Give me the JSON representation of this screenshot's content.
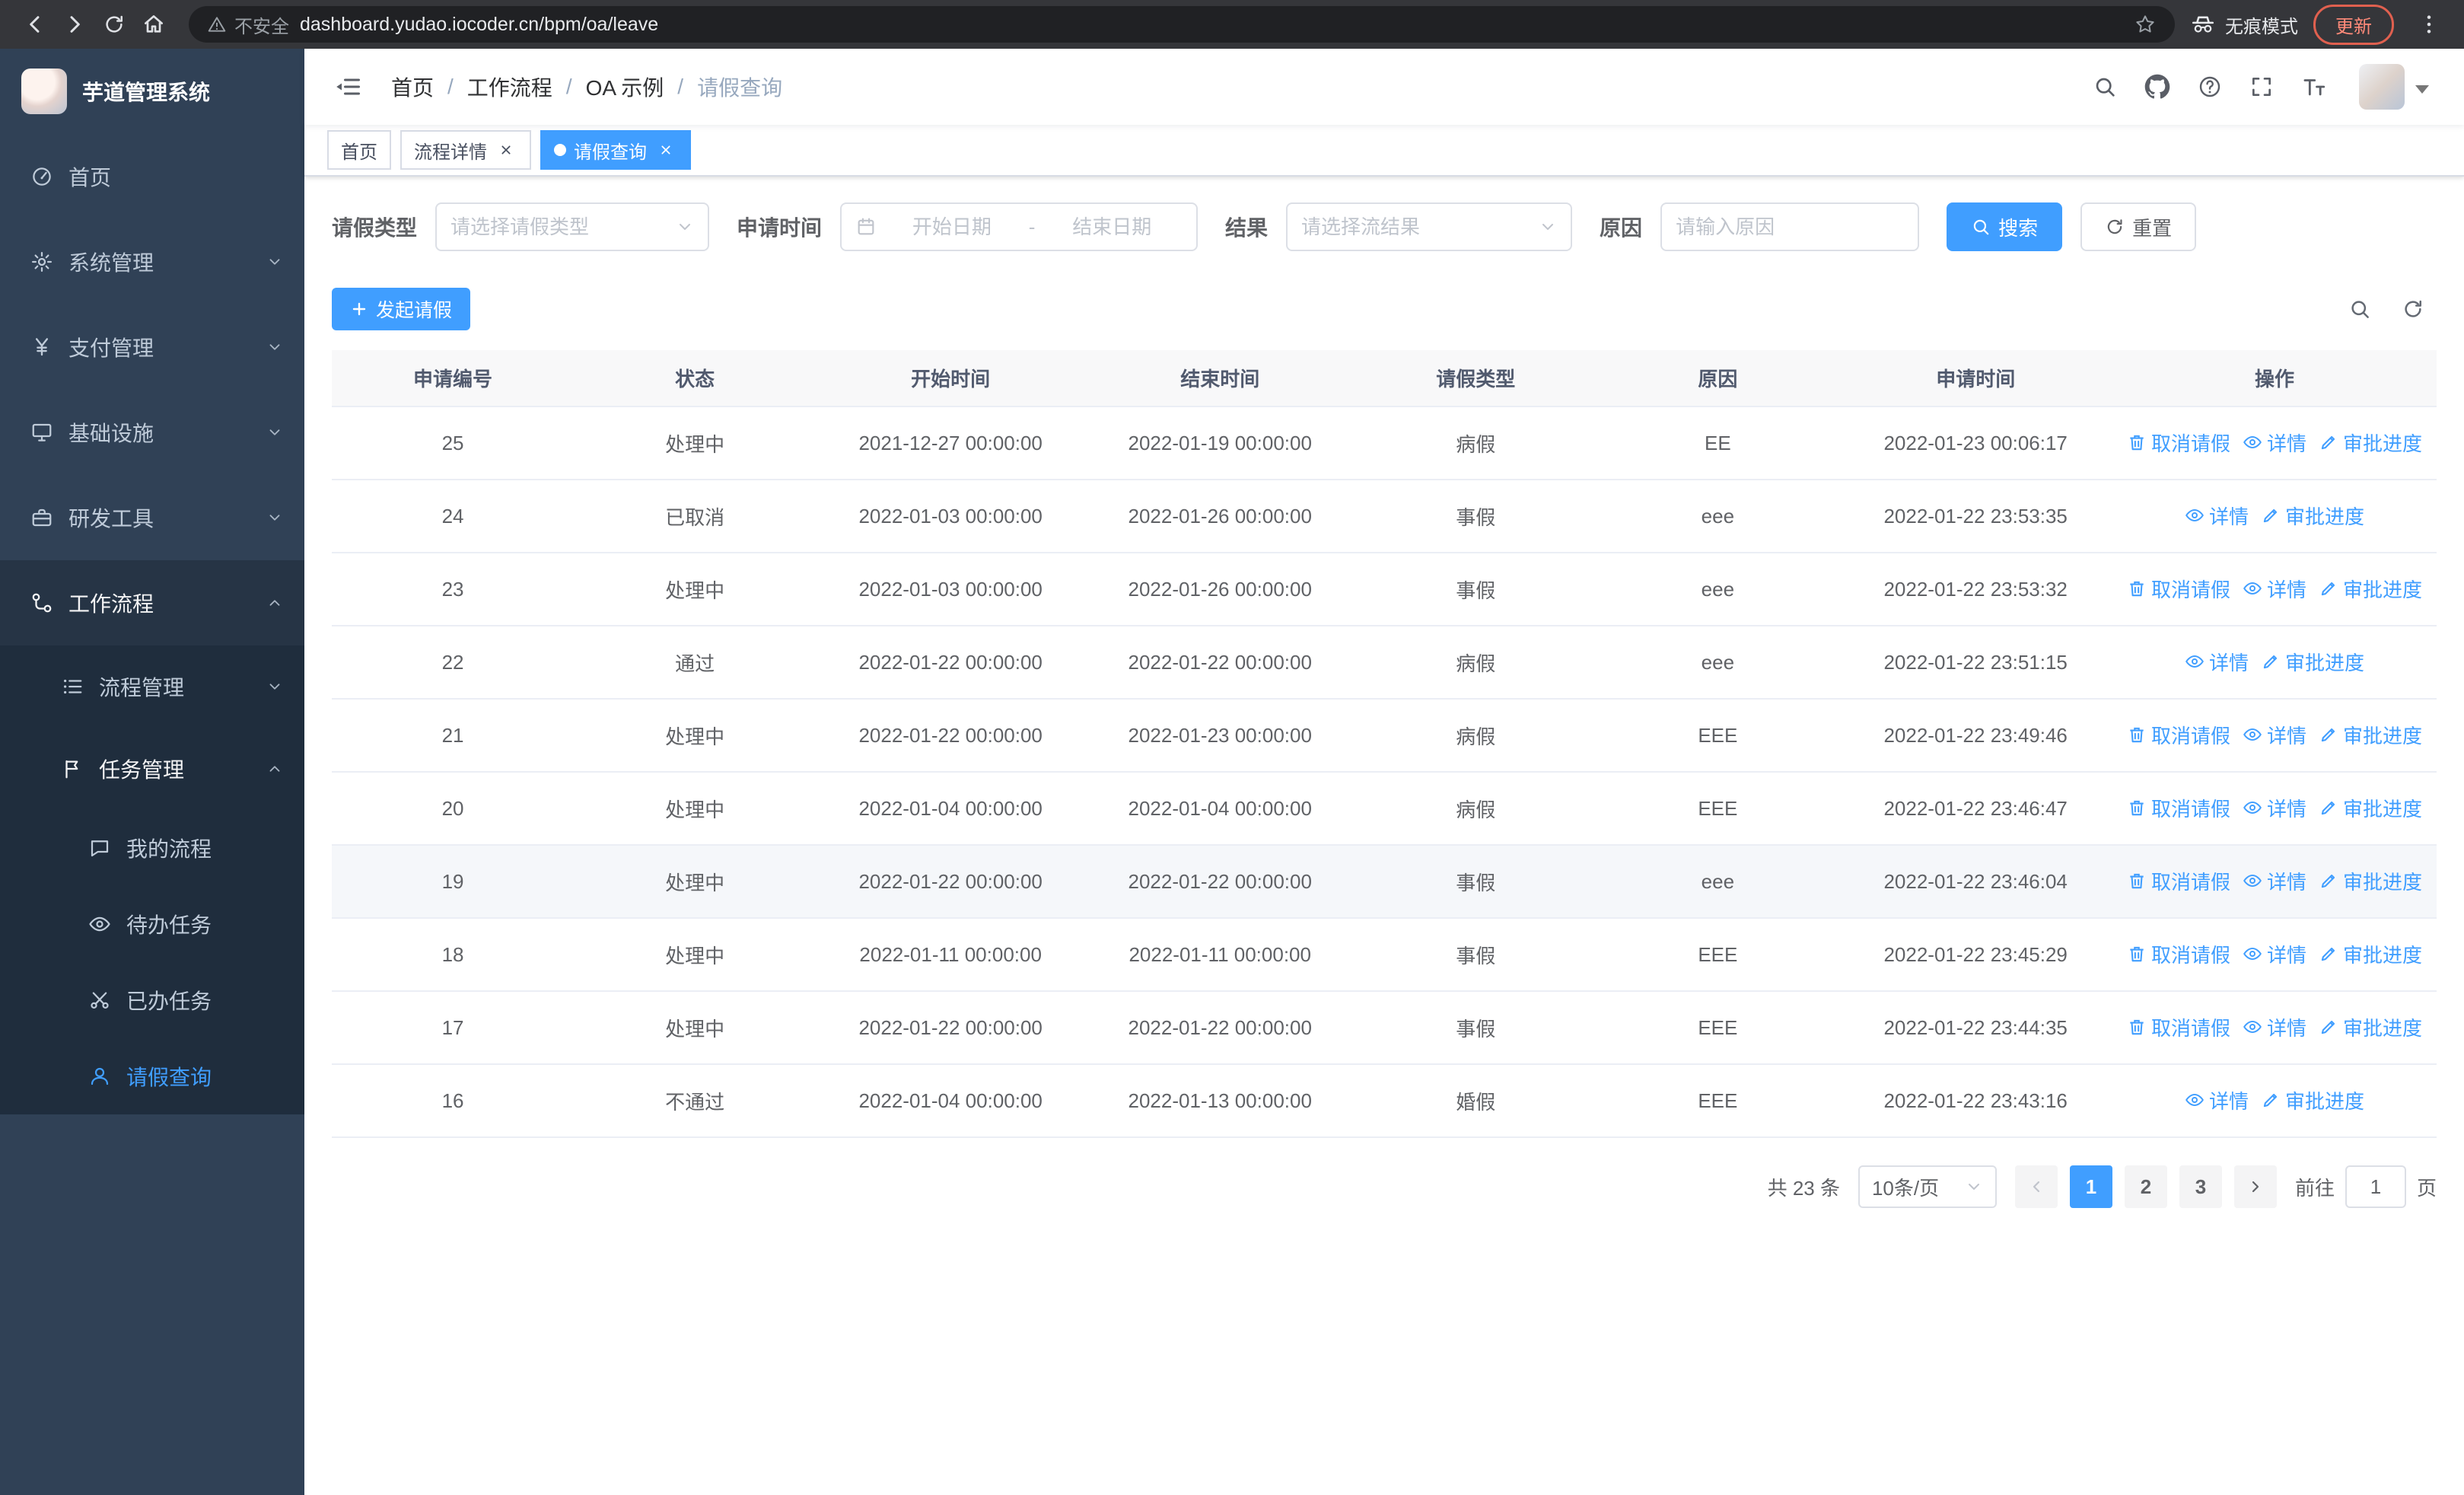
{
  "browser": {
    "security_label": "不安全",
    "url": "dashboard.yudao.iocoder.cn/bpm/oa/leave",
    "incognito_label": "无痕模式",
    "update_label": "更新"
  },
  "sidebar": {
    "logo_title": "芋道管理系统",
    "items": [
      {
        "label": "首页"
      },
      {
        "label": "系统管理"
      },
      {
        "label": "支付管理"
      },
      {
        "label": "基础设施"
      },
      {
        "label": "研发工具"
      },
      {
        "label": "工作流程"
      },
      {
        "label": "流程管理"
      },
      {
        "label": "任务管理"
      },
      {
        "label": "我的流程"
      },
      {
        "label": "待办任务"
      },
      {
        "label": "已办任务"
      },
      {
        "label": "请假查询"
      }
    ]
  },
  "header": {
    "separator": "/",
    "breadcrumb": [
      {
        "label": "首页"
      },
      {
        "label": "工作流程"
      },
      {
        "label": "OA 示例"
      },
      {
        "label": "请假查询"
      }
    ]
  },
  "tags": [
    {
      "label": "首页"
    },
    {
      "label": "流程详情"
    },
    {
      "label": "请假查询"
    }
  ],
  "filters": {
    "leave_type_label": "请假类型",
    "leave_type_placeholder": "请选择请假类型",
    "apply_time_label": "申请时间",
    "start_date_placeholder": "开始日期",
    "range_separator": "-",
    "end_date_placeholder": "结束日期",
    "result_label": "结果",
    "result_placeholder": "请选择流结果",
    "reason_label": "原因",
    "reason_placeholder": "请输入原因",
    "search_label": "搜索",
    "reset_label": "重置"
  },
  "toolbar": {
    "create_label": "发起请假"
  },
  "table": {
    "columns": [
      "申请编号",
      "状态",
      "开始时间",
      "结束时间",
      "请假类型",
      "原因",
      "申请时间",
      "操作"
    ],
    "action_labels": {
      "cancel": "取消请假",
      "detail": "详情",
      "progress": "审批进度"
    },
    "rows": [
      {
        "id": "25",
        "status": "处理中",
        "start": "2021-12-27 00:00:00",
        "end": "2022-01-19 00:00:00",
        "type": "病假",
        "reason": "EE",
        "apply_time": "2022-01-23 00:06:17",
        "actions": [
          "cancel",
          "detail",
          "progress"
        ]
      },
      {
        "id": "24",
        "status": "已取消",
        "start": "2022-01-03 00:00:00",
        "end": "2022-01-26 00:00:00",
        "type": "事假",
        "reason": "eee",
        "apply_time": "2022-01-22 23:53:35",
        "actions": [
          "detail",
          "progress"
        ]
      },
      {
        "id": "23",
        "status": "处理中",
        "start": "2022-01-03 00:00:00",
        "end": "2022-01-26 00:00:00",
        "type": "事假",
        "reason": "eee",
        "apply_time": "2022-01-22 23:53:32",
        "actions": [
          "cancel",
          "detail",
          "progress"
        ]
      },
      {
        "id": "22",
        "status": "通过",
        "start": "2022-01-22 00:00:00",
        "end": "2022-01-22 00:00:00",
        "type": "病假",
        "reason": "eee",
        "apply_time": "2022-01-22 23:51:15",
        "actions": [
          "detail",
          "progress"
        ]
      },
      {
        "id": "21",
        "status": "处理中",
        "start": "2022-01-22 00:00:00",
        "end": "2022-01-23 00:00:00",
        "type": "病假",
        "reason": "EEE",
        "apply_time": "2022-01-22 23:49:46",
        "actions": [
          "cancel",
          "detail",
          "progress"
        ]
      },
      {
        "id": "20",
        "status": "处理中",
        "start": "2022-01-04 00:00:00",
        "end": "2022-01-04 00:00:00",
        "type": "病假",
        "reason": "EEE",
        "apply_time": "2022-01-22 23:46:47",
        "actions": [
          "cancel",
          "detail",
          "progress"
        ]
      },
      {
        "id": "19",
        "status": "处理中",
        "start": "2022-01-22 00:00:00",
        "end": "2022-01-22 00:00:00",
        "type": "事假",
        "reason": "eee",
        "apply_time": "2022-01-22 23:46:04",
        "actions": [
          "cancel",
          "detail",
          "progress"
        ],
        "highlight": true
      },
      {
        "id": "18",
        "status": "处理中",
        "start": "2022-01-11 00:00:00",
        "end": "2022-01-11 00:00:00",
        "type": "事假",
        "reason": "EEE",
        "apply_time": "2022-01-22 23:45:29",
        "actions": [
          "cancel",
          "detail",
          "progress"
        ]
      },
      {
        "id": "17",
        "status": "处理中",
        "start": "2022-01-22 00:00:00",
        "end": "2022-01-22 00:00:00",
        "type": "事假",
        "reason": "EEE",
        "apply_time": "2022-01-22 23:44:35",
        "actions": [
          "cancel",
          "detail",
          "progress"
        ]
      },
      {
        "id": "16",
        "status": "不通过",
        "start": "2022-01-04 00:00:00",
        "end": "2022-01-13 00:00:00",
        "type": "婚假",
        "reason": "EEE",
        "apply_time": "2022-01-22 23:43:16",
        "actions": [
          "detail",
          "progress"
        ]
      }
    ]
  },
  "pagination": {
    "total_label": "共 23 条",
    "page_size_label": "10条/页",
    "pages": [
      "1",
      "2",
      "3"
    ],
    "goto_label": "前往",
    "goto_value": "1",
    "page_suffix": "页"
  }
}
